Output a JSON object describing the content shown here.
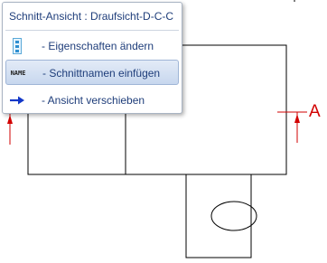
{
  "menu": {
    "title": "Schnitt-Ansicht : Draufsicht-D-C-C",
    "items": [
      {
        "label": "- Eigenschaften ändern",
        "icon": "properties-icon",
        "highlighted": false
      },
      {
        "label": "- Schnittnamen einfügen",
        "icon": "name-tag-icon",
        "icon_text": "NAME",
        "highlighted": true
      },
      {
        "label": "- Ansicht verschieben",
        "icon": "arrow-right-icon",
        "highlighted": false
      }
    ]
  },
  "drawing": {
    "section_label": "A",
    "colors": {
      "lines": "#000000",
      "section_marker": "#d20000",
      "menu_text": "#1e3d7a",
      "highlight": "#c7d7ee"
    }
  }
}
